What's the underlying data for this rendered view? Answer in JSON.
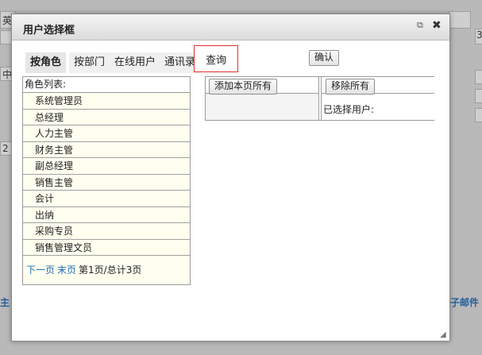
{
  "background": {
    "left_labels": [
      "英",
      "中",
      "2"
    ],
    "bottom_left": "主",
    "bottom_right": "子邮件",
    "right_label": "3"
  },
  "dialog": {
    "title": "用户选择框",
    "tabs": [
      "按角色",
      "按部门",
      "在线用户",
      "通讯录",
      "查询"
    ],
    "active_tab": "按角色",
    "confirm_label": "确认",
    "role_list_header": "角色列表:",
    "roles": [
      "系统管理员",
      "总经理",
      "人力主管",
      "财务主管",
      "副总经理",
      "销售主管",
      "会计",
      "出纳",
      "采购专员",
      "销售管理文员"
    ],
    "pager": {
      "next": "下一页",
      "last": "末页",
      "info": "第1页/总计3页"
    },
    "add_all_label": "添加本页所有",
    "remove_all_label": "移除所有",
    "selected_users_label": "已选择用户:"
  }
}
